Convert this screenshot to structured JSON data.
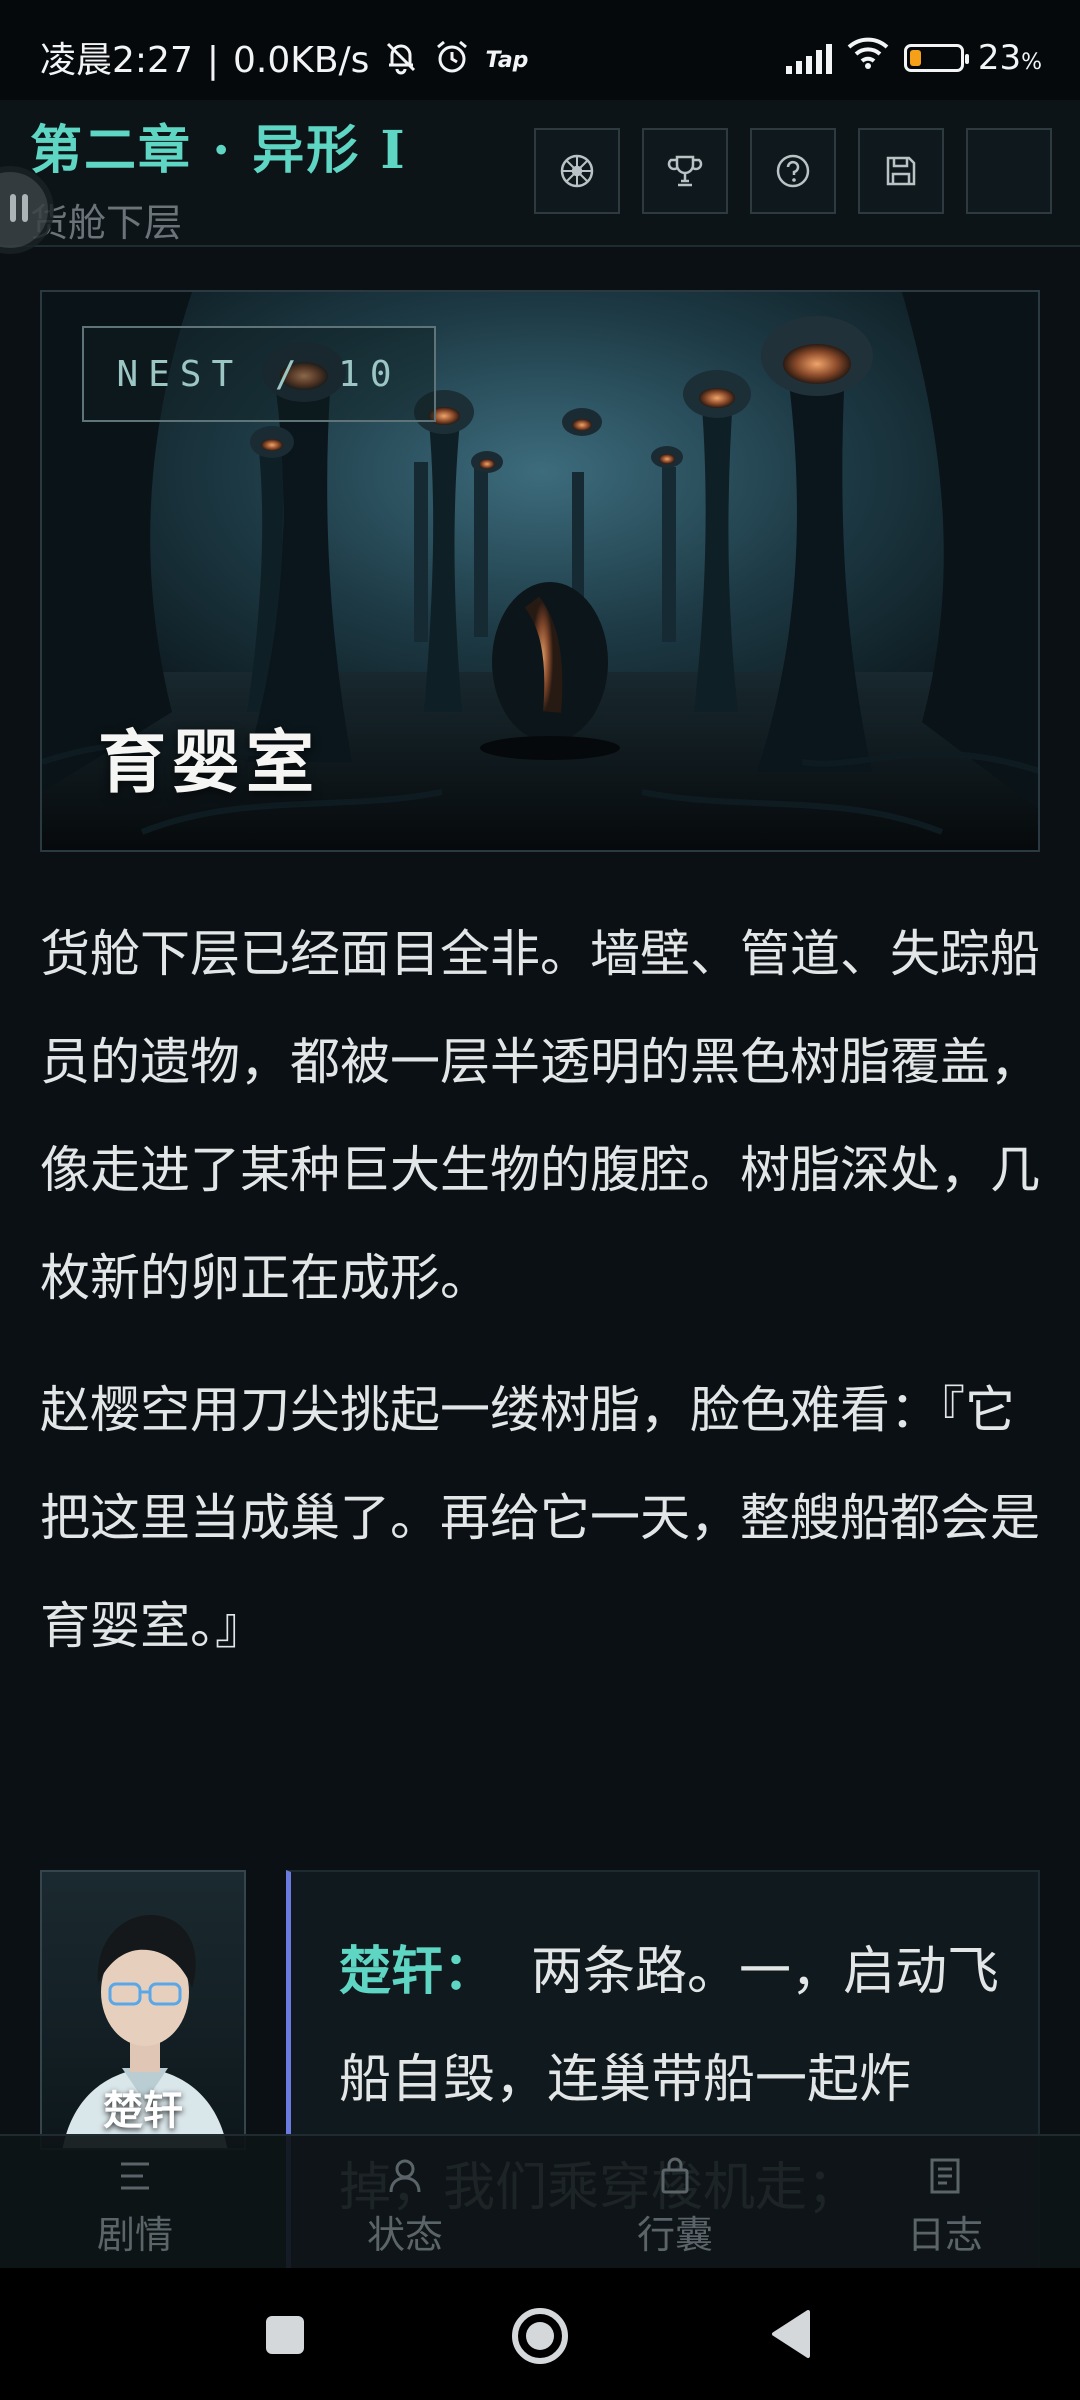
{
  "status_bar": {
    "time": "凌晨2:27",
    "separator": "|",
    "net_speed": "0.0KB/s",
    "app_badge": "Tap",
    "battery_text": "23",
    "battery_unit": "%",
    "battery_level": 0.23,
    "icons": [
      "mute-bell-icon",
      "alarm-icon",
      "signal-icon",
      "wifi-icon",
      "battery-icon"
    ]
  },
  "header": {
    "chapter_title": "第二章 · 异形 I",
    "location": "货舱下层",
    "tools": [
      "compass-icon",
      "trophy-icon",
      "help-icon",
      "save-icon",
      "blank"
    ]
  },
  "scene": {
    "tag": "NEST / 10",
    "title": "育婴室"
  },
  "narrative": {
    "paragraphs": [
      "货舱下层已经面目全非。墙壁、管道、失踪船员的遗物，都被一层半透明的黑色树脂覆盖，像走进了某种巨大生物的腹腔。树脂深处，几枚新的卵正在成形。",
      "赵樱空用刀尖挑起一缕树脂，脸色难看：『它把这里当成巢了。再给它一天，整艘船都会是育婴室。』"
    ]
  },
  "dialogue": {
    "avatar_name": "楚轩",
    "speaker": "楚轩：",
    "text": "两条路。一，启动飞船自毁，连巢带船一起炸掉，我们乘穿梭机走；二，……控制核心……"
  },
  "bottom_nav": {
    "items": [
      {
        "label": "剧情",
        "icon": "menu-lines-icon"
      },
      {
        "label": "状态",
        "icon": "user-icon"
      },
      {
        "label": "行囊",
        "icon": "bag-icon"
      },
      {
        "label": "日志",
        "icon": "log-icon"
      }
    ]
  },
  "colors": {
    "accent": "#5fd6c3",
    "background": "#0b1014",
    "dialogue_border": "#6c7be0"
  }
}
